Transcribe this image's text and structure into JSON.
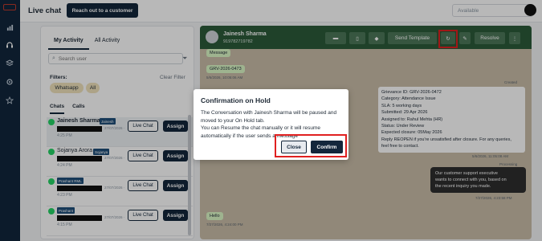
{
  "topbar": {
    "title": "Live chat",
    "reach_button": "Reach out to a customer",
    "status_value": "Available"
  },
  "left_panel": {
    "tabs": [
      "My Activity",
      "All Activity"
    ],
    "search_placeholder": "Search user",
    "filters_label": "Filters:",
    "clear_filter": "Clear Filter",
    "chips": [
      "Whatsapp",
      "All"
    ],
    "subtabs": [
      "Chats",
      "Calls"
    ],
    "live_chat_label": "Live Chat",
    "assign_label": "Assign",
    "conversations": [
      {
        "name": "Jainesh Sharma",
        "badge": "Jainesh",
        "date": "27/07/2026 ·",
        "time": "4:25 PM"
      },
      {
        "name": "Sojanya Arora",
        "badge": "Sojanya",
        "date": "27/07/2026 ·",
        "time": "4:24 PM"
      },
      {
        "name": "",
        "badge": "Prashant RML",
        "date": "27/07/2026 ·",
        "time": "4:23 PM"
      },
      {
        "name": "",
        "badge": "Prashant",
        "date": "27/07/2026 ·",
        "time": "4:15 PM"
      }
    ]
  },
  "chat": {
    "contact_name": "Jainesh Sharma",
    "contact_phone": "919782719782",
    "send_template": "Send Template",
    "resolve": "Resolve",
    "messages": {
      "m1_text": "Message",
      "m2_text": "GRV-2026-0473",
      "m2_ts": "5/6/2026, 10:05:06 AM",
      "created_label": "Created",
      "grievance_lines": [
        "Grievance ID: GRV-2026-0472",
        "Category: Attendance Issue",
        "SLA: 5 working days",
        "Submitted: 29 Apr 2026",
        "Assigned to: Rahul Mehta (HR)",
        "Status: Under Review",
        "Expected closure: 05May 2026",
        "Reply REOPEN if you're unsatisfied after closure. For any queries,",
        "feel free to contact."
      ],
      "grievance_ts": "5/6/2026, 11:05:08 AM",
      "processing_label": "Processing",
      "dark_lines": [
        "Our customer support executive",
        "wants to connect with you, based on",
        "the recent inquiry you made."
      ],
      "dark_ts": "7/27/2026, 4:23:58 PM",
      "hello_text": "Hello",
      "hello_ts": "7/27/2026, 4:24:00 PM"
    }
  },
  "modal": {
    "title": "Confirmation on Hold",
    "body_lines": [
      "The Conversation with Jainesh Sharma will be paused and",
      "moved to your On Hold tab.",
      "You can Resume the chat manually or it will resume",
      "automatically if the user sends a message"
    ],
    "close_label": "Close",
    "confirm_label": "Confirm"
  },
  "colors": {
    "primary_navy": "#13263b",
    "chat_header_green": "#2b5a39",
    "highlight_red": "#e02020",
    "chip_yellow": "#f0e2bb"
  }
}
